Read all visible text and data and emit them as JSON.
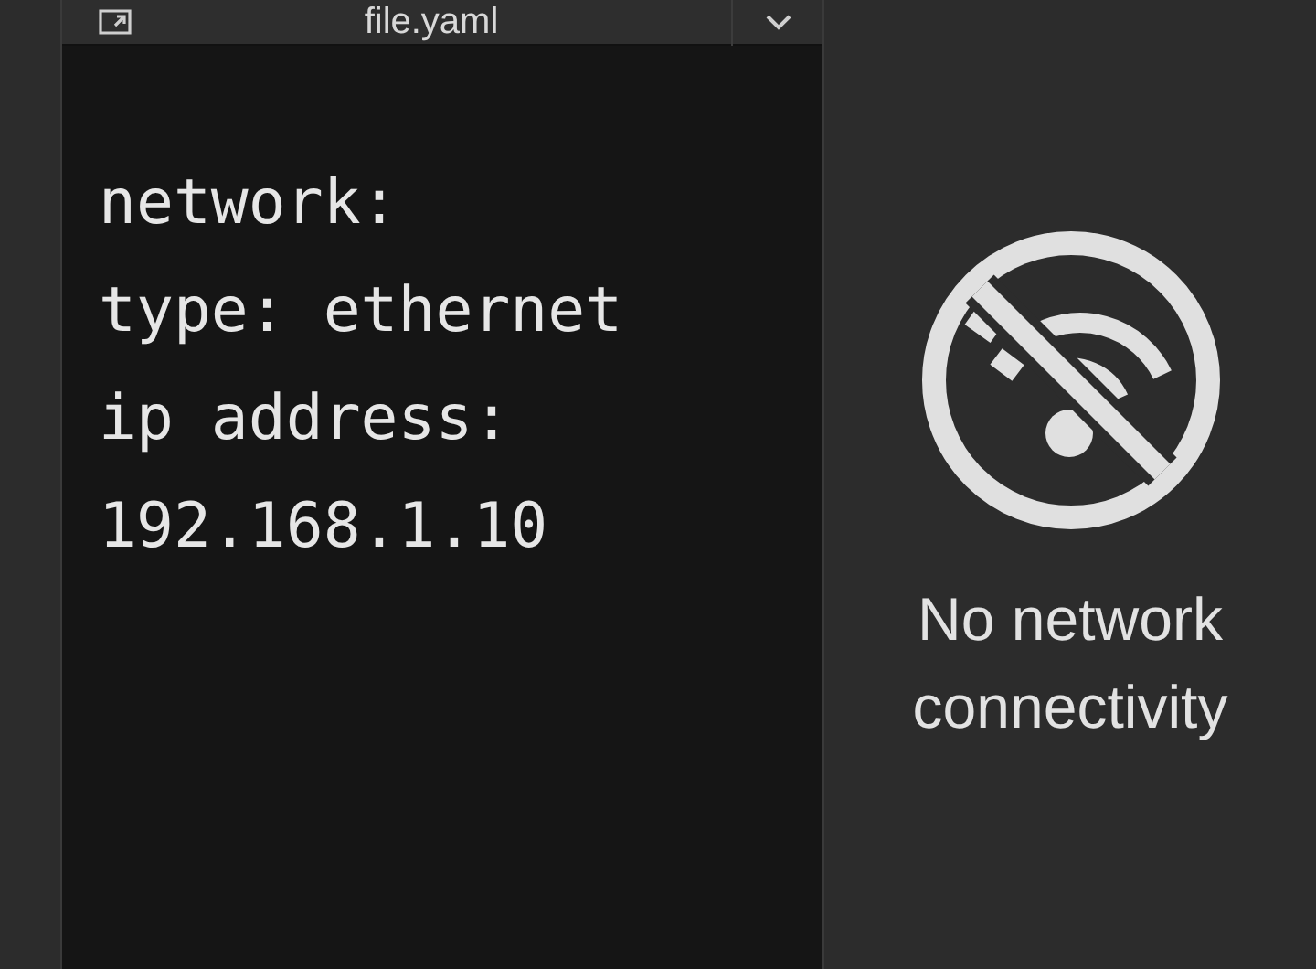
{
  "editor": {
    "title": "file.yaml",
    "lines": [
      "network:",
      "type: ethernet",
      "ip address:",
      "192.168.1.10"
    ]
  },
  "status": {
    "message": "No network connectivity"
  }
}
